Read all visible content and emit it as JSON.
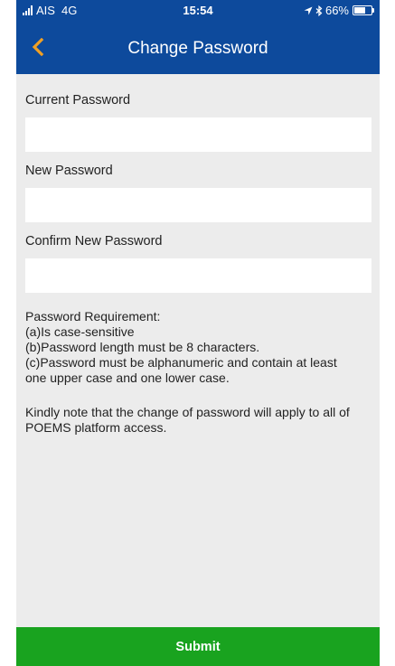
{
  "status_bar": {
    "carrier": "AIS",
    "network": "4G",
    "time": "15:54",
    "battery_percent": "66%",
    "battery_level": 0.66
  },
  "header": {
    "title": "Change Password"
  },
  "form": {
    "current_password_label": "Current Password",
    "current_password_value": "",
    "new_password_label": "New Password",
    "new_password_value": "",
    "confirm_password_label": "Confirm New Password",
    "confirm_password_value": ""
  },
  "requirements": {
    "heading": "Password Requirement:",
    "lines": [
      "(a)Is case-sensitive",
      "(b)Password length must be 8 characters.",
      "(c)Password must be alphanumeric and contain at least",
      "one upper case and one lower case."
    ]
  },
  "notice": {
    "lines": [
      "Kindly note that the change of password will apply to all of",
      "POEMS platform access."
    ]
  },
  "submit_label": "Submit",
  "colors": {
    "header_bg": "#0d4a9c",
    "back_arrow": "#f0a024",
    "submit_bg": "#19a31f",
    "page_bg": "#ececec"
  },
  "icons": {
    "signal": "signal-icon",
    "location": "location-arrow-icon",
    "bluetooth": "bluetooth-icon",
    "battery": "battery-icon",
    "back": "chevron-left-icon"
  }
}
